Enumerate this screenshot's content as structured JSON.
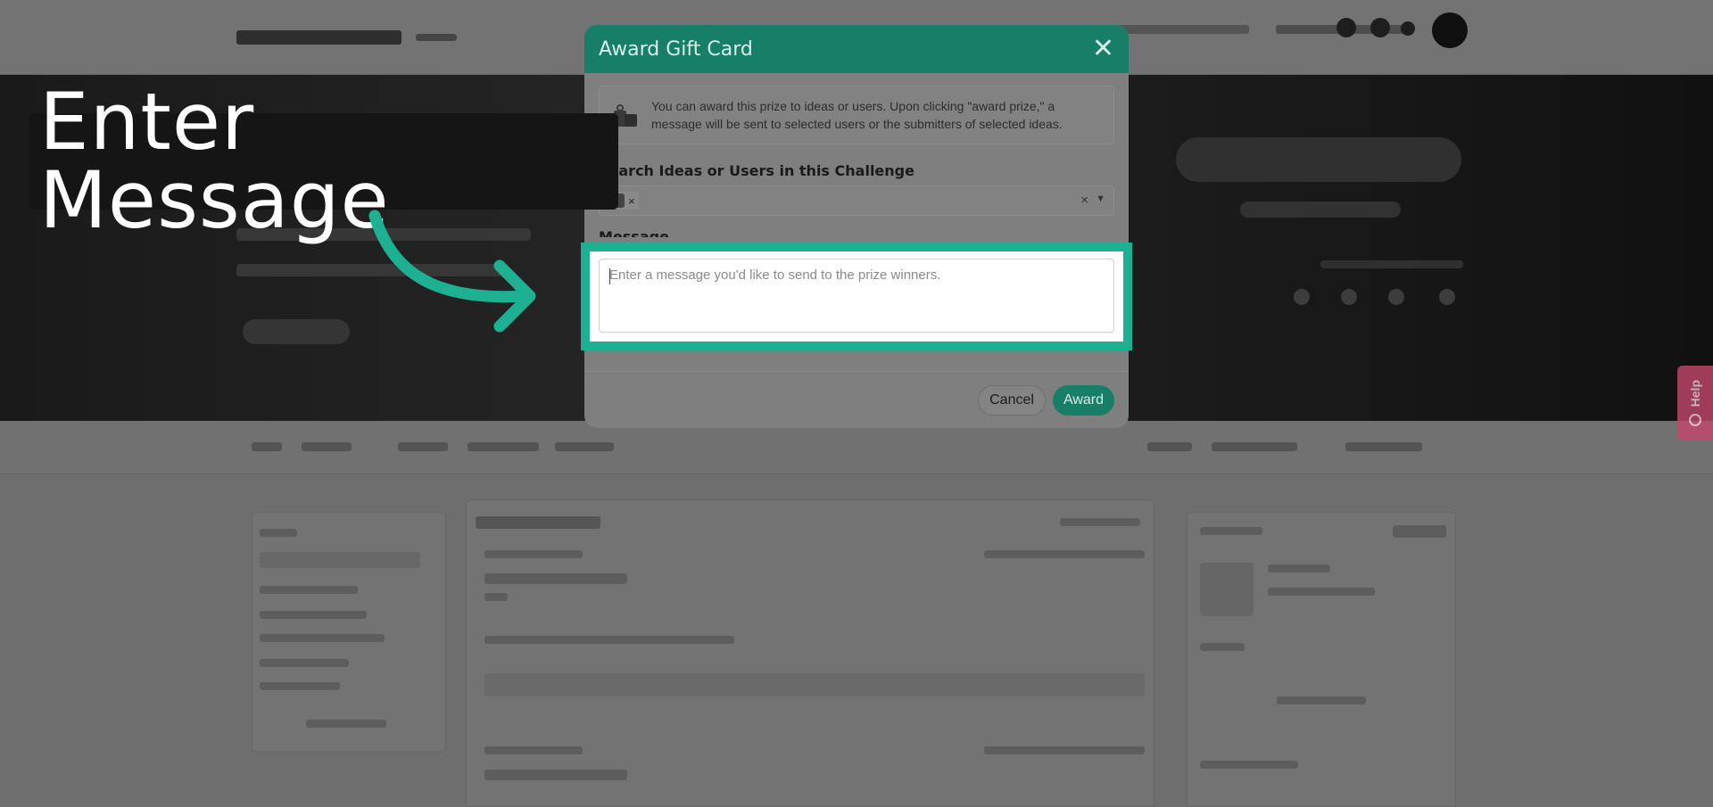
{
  "annotation": {
    "callout_text": "Enter Message",
    "highlight_color": "#1eb092"
  },
  "modal": {
    "title": "Award Gift Card",
    "close_icon": "close-icon",
    "info_icon": "gift-icon",
    "info_text": "You can award this prize to ideas or users. Upon clicking \"award prize,\" a message will be sent to selected users or the submitters of selected ideas.",
    "search_label": "Search Ideas or Users in this Challenge",
    "selected_chip_remove": "×",
    "select_clear": "×",
    "message_label": "Message",
    "message_placeholder": "Enter a message you'd like to send to the prize winners.",
    "message_value": "",
    "cancel_label": "Cancel",
    "award_label": "Award",
    "accent_color": "#177f68"
  },
  "help_tab": {
    "label": "Help"
  }
}
